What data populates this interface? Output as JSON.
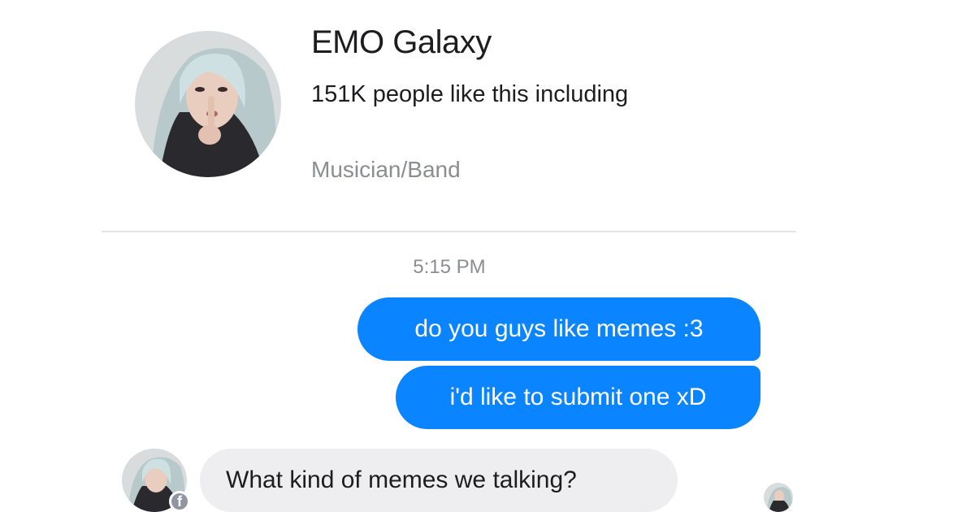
{
  "page": {
    "name": "EMO Galaxy",
    "likes": "151K people like this including",
    "category": "Musician/Band",
    "avatar_icon": "profile-photo-avatar"
  },
  "conversation": {
    "timestamp": "5:15 PM",
    "messages": [
      {
        "direction": "outgoing",
        "text": "do you guys like memes :3"
      },
      {
        "direction": "outgoing",
        "text": "i'd like to submit one xD"
      },
      {
        "direction": "incoming",
        "text": "What kind of memes we talking?"
      }
    ],
    "sender_badge": "f",
    "seen_indicator_icon": "seen-avatar"
  },
  "colors": {
    "outgoing_bubble": "#0a84ff",
    "incoming_bubble": "#eeeef0",
    "text_primary": "#1d1d1f",
    "text_secondary": "#8b8d91"
  }
}
